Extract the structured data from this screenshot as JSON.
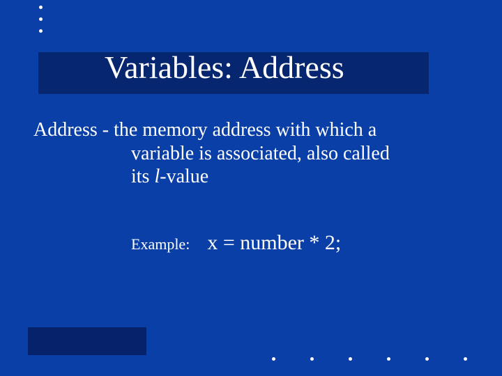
{
  "slide": {
    "title": "Variables:  Address",
    "definition_line1": "Address - the memory address with which a",
    "definition_line2": "variable is associated, also called",
    "definition_line3_before_italic": "its ",
    "definition_line3_italic": "l",
    "definition_line3_after_italic": "-value",
    "example_label": "Example:",
    "example_code": "x = number * 2;"
  }
}
